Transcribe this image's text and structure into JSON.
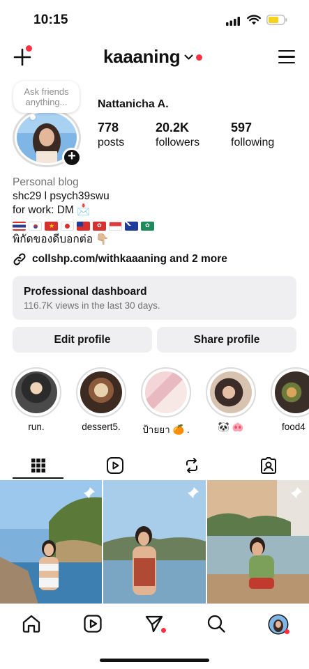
{
  "status_bar": {
    "time": "10:15"
  },
  "header": {
    "username": "kaaaning"
  },
  "note": {
    "text": "Ask friends anything..."
  },
  "profile": {
    "display_name": "Nattanicha A.",
    "stats": [
      {
        "value": "778",
        "label": "posts"
      },
      {
        "value": "20.2K",
        "label": "followers"
      },
      {
        "value": "597",
        "label": "following"
      }
    ]
  },
  "bio": {
    "category": "Personal blog",
    "line1": "shc29 l psych39swu",
    "line2": "for work: DM 📩",
    "line4": "พิกัดของดีบอกต่อ 👇🏼",
    "link": "collshp.com/withkaaaning and 2 more"
  },
  "dashboard": {
    "title": "Professional dashboard",
    "subtitle": "116.7K views in the last 30 days."
  },
  "buttons": {
    "edit": "Edit profile",
    "share": "Share profile"
  },
  "highlights": [
    {
      "label": "run."
    },
    {
      "label": "dessert5."
    },
    {
      "label": "ป้ายยา 🍊 ."
    },
    {
      "label": "🐼 🐽"
    },
    {
      "label": "food4"
    }
  ],
  "colors": {
    "accent_dot": "#ff3040",
    "button_bg": "#efeff2",
    "secondary_text": "#737373"
  },
  "icons": {
    "tabs": [
      "grid-icon",
      "reels-icon",
      "reposts-icon",
      "tagged-icon"
    ],
    "bottom_nav": [
      "home-icon",
      "reels-icon",
      "direct-message-icon",
      "search-icon",
      "profile-avatar"
    ]
  }
}
